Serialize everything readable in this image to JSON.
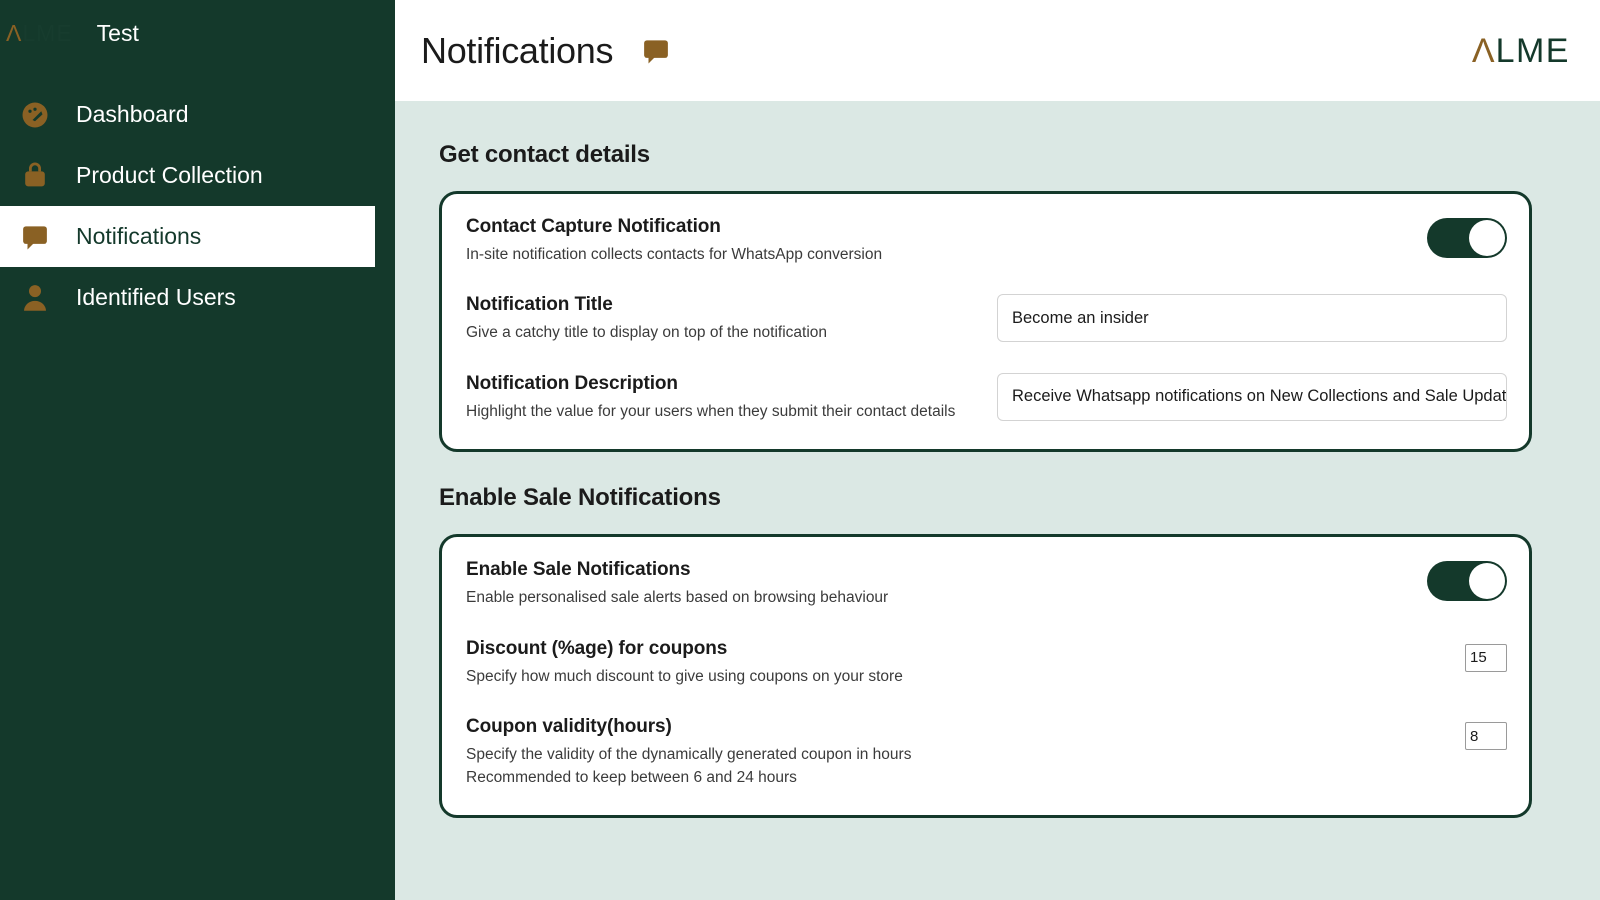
{
  "sidebar": {
    "logo": {
      "chevron": "Λ",
      "rest": "LME",
      "icon": "alme-logo-icon"
    },
    "store_name": "Test",
    "items": [
      {
        "label": "Dashboard",
        "icon": "dashboard-gauge-icon",
        "active": false
      },
      {
        "label": "Product Collection",
        "icon": "shopping-bag-icon",
        "active": false
      },
      {
        "label": "Notifications",
        "icon": "speech-bubble-icon",
        "active": true
      },
      {
        "label": "Identified Users",
        "icon": "user-person-icon",
        "active": false
      }
    ]
  },
  "header": {
    "title": "Notifications",
    "title_icon": "speech-bubble-icon",
    "brand": {
      "chevron": "Λ",
      "rest": "LME"
    }
  },
  "sections": [
    {
      "heading": "Get contact details",
      "rows": [
        {
          "label": "Contact Capture Notification",
          "desc": "In-site notification collects contacts for WhatsApp conversion",
          "control": "toggle",
          "toggle_on": true
        },
        {
          "label": "Notification Title",
          "desc": "Give a catchy title to display on top of the notification",
          "control": "text",
          "value": "Become an insider"
        },
        {
          "label": "Notification Description",
          "desc": "Highlight the value for your users when they submit their contact details",
          "control": "text",
          "value": "Receive Whatsapp notifications on New Collections and Sale Updates"
        }
      ]
    },
    {
      "heading": "Enable Sale Notifications",
      "rows": [
        {
          "label": "Enable Sale Notifications",
          "desc": "Enable personalised sale alerts based on browsing behaviour",
          "control": "toggle",
          "toggle_on": true
        },
        {
          "label": "Discount (%age) for coupons",
          "desc": "Specify how much discount to give using coupons on your store",
          "control": "number",
          "value": "15"
        },
        {
          "label": "Coupon validity(hours)",
          "desc": "Specify the validity of the dynamically generated coupon in hours",
          "desc2": "Recommended to keep between 6 and 24 hours",
          "control": "number",
          "value": "8"
        }
      ]
    }
  ],
  "colors": {
    "sidebar_bg": "#14392b",
    "page_bg": "#dbe8e4",
    "accent_brown": "#8a6124",
    "card_border": "#14392b",
    "toggle_on": "#14392b"
  }
}
